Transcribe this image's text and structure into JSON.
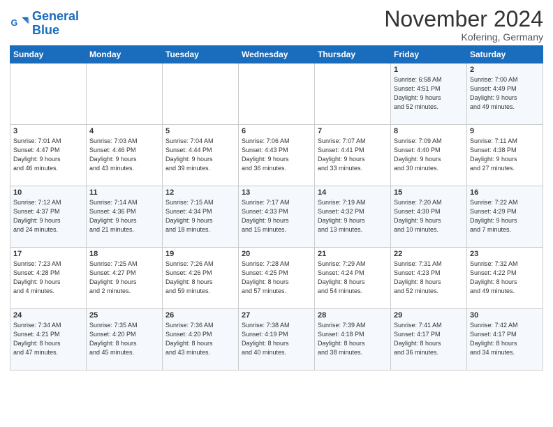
{
  "header": {
    "title": "November 2024",
    "subtitle": "Kofering, Germany",
    "logo_line1": "General",
    "logo_line2": "Blue"
  },
  "days_of_week": [
    "Sunday",
    "Monday",
    "Tuesday",
    "Wednesday",
    "Thursday",
    "Friday",
    "Saturday"
  ],
  "weeks": [
    [
      {
        "num": "",
        "info": ""
      },
      {
        "num": "",
        "info": ""
      },
      {
        "num": "",
        "info": ""
      },
      {
        "num": "",
        "info": ""
      },
      {
        "num": "",
        "info": ""
      },
      {
        "num": "1",
        "info": "Sunrise: 6:58 AM\nSunset: 4:51 PM\nDaylight: 9 hours\nand 52 minutes."
      },
      {
        "num": "2",
        "info": "Sunrise: 7:00 AM\nSunset: 4:49 PM\nDaylight: 9 hours\nand 49 minutes."
      }
    ],
    [
      {
        "num": "3",
        "info": "Sunrise: 7:01 AM\nSunset: 4:47 PM\nDaylight: 9 hours\nand 46 minutes."
      },
      {
        "num": "4",
        "info": "Sunrise: 7:03 AM\nSunset: 4:46 PM\nDaylight: 9 hours\nand 43 minutes."
      },
      {
        "num": "5",
        "info": "Sunrise: 7:04 AM\nSunset: 4:44 PM\nDaylight: 9 hours\nand 39 minutes."
      },
      {
        "num": "6",
        "info": "Sunrise: 7:06 AM\nSunset: 4:43 PM\nDaylight: 9 hours\nand 36 minutes."
      },
      {
        "num": "7",
        "info": "Sunrise: 7:07 AM\nSunset: 4:41 PM\nDaylight: 9 hours\nand 33 minutes."
      },
      {
        "num": "8",
        "info": "Sunrise: 7:09 AM\nSunset: 4:40 PM\nDaylight: 9 hours\nand 30 minutes."
      },
      {
        "num": "9",
        "info": "Sunrise: 7:11 AM\nSunset: 4:38 PM\nDaylight: 9 hours\nand 27 minutes."
      }
    ],
    [
      {
        "num": "10",
        "info": "Sunrise: 7:12 AM\nSunset: 4:37 PM\nDaylight: 9 hours\nand 24 minutes."
      },
      {
        "num": "11",
        "info": "Sunrise: 7:14 AM\nSunset: 4:36 PM\nDaylight: 9 hours\nand 21 minutes."
      },
      {
        "num": "12",
        "info": "Sunrise: 7:15 AM\nSunset: 4:34 PM\nDaylight: 9 hours\nand 18 minutes."
      },
      {
        "num": "13",
        "info": "Sunrise: 7:17 AM\nSunset: 4:33 PM\nDaylight: 9 hours\nand 15 minutes."
      },
      {
        "num": "14",
        "info": "Sunrise: 7:19 AM\nSunset: 4:32 PM\nDaylight: 9 hours\nand 13 minutes."
      },
      {
        "num": "15",
        "info": "Sunrise: 7:20 AM\nSunset: 4:30 PM\nDaylight: 9 hours\nand 10 minutes."
      },
      {
        "num": "16",
        "info": "Sunrise: 7:22 AM\nSunset: 4:29 PM\nDaylight: 9 hours\nand 7 minutes."
      }
    ],
    [
      {
        "num": "17",
        "info": "Sunrise: 7:23 AM\nSunset: 4:28 PM\nDaylight: 9 hours\nand 4 minutes."
      },
      {
        "num": "18",
        "info": "Sunrise: 7:25 AM\nSunset: 4:27 PM\nDaylight: 9 hours\nand 2 minutes."
      },
      {
        "num": "19",
        "info": "Sunrise: 7:26 AM\nSunset: 4:26 PM\nDaylight: 8 hours\nand 59 minutes."
      },
      {
        "num": "20",
        "info": "Sunrise: 7:28 AM\nSunset: 4:25 PM\nDaylight: 8 hours\nand 57 minutes."
      },
      {
        "num": "21",
        "info": "Sunrise: 7:29 AM\nSunset: 4:24 PM\nDaylight: 8 hours\nand 54 minutes."
      },
      {
        "num": "22",
        "info": "Sunrise: 7:31 AM\nSunset: 4:23 PM\nDaylight: 8 hours\nand 52 minutes."
      },
      {
        "num": "23",
        "info": "Sunrise: 7:32 AM\nSunset: 4:22 PM\nDaylight: 8 hours\nand 49 minutes."
      }
    ],
    [
      {
        "num": "24",
        "info": "Sunrise: 7:34 AM\nSunset: 4:21 PM\nDaylight: 8 hours\nand 47 minutes."
      },
      {
        "num": "25",
        "info": "Sunrise: 7:35 AM\nSunset: 4:20 PM\nDaylight: 8 hours\nand 45 minutes."
      },
      {
        "num": "26",
        "info": "Sunrise: 7:36 AM\nSunset: 4:20 PM\nDaylight: 8 hours\nand 43 minutes."
      },
      {
        "num": "27",
        "info": "Sunrise: 7:38 AM\nSunset: 4:19 PM\nDaylight: 8 hours\nand 40 minutes."
      },
      {
        "num": "28",
        "info": "Sunrise: 7:39 AM\nSunset: 4:18 PM\nDaylight: 8 hours\nand 38 minutes."
      },
      {
        "num": "29",
        "info": "Sunrise: 7:41 AM\nSunset: 4:17 PM\nDaylight: 8 hours\nand 36 minutes."
      },
      {
        "num": "30",
        "info": "Sunrise: 7:42 AM\nSunset: 4:17 PM\nDaylight: 8 hours\nand 34 minutes."
      }
    ]
  ]
}
